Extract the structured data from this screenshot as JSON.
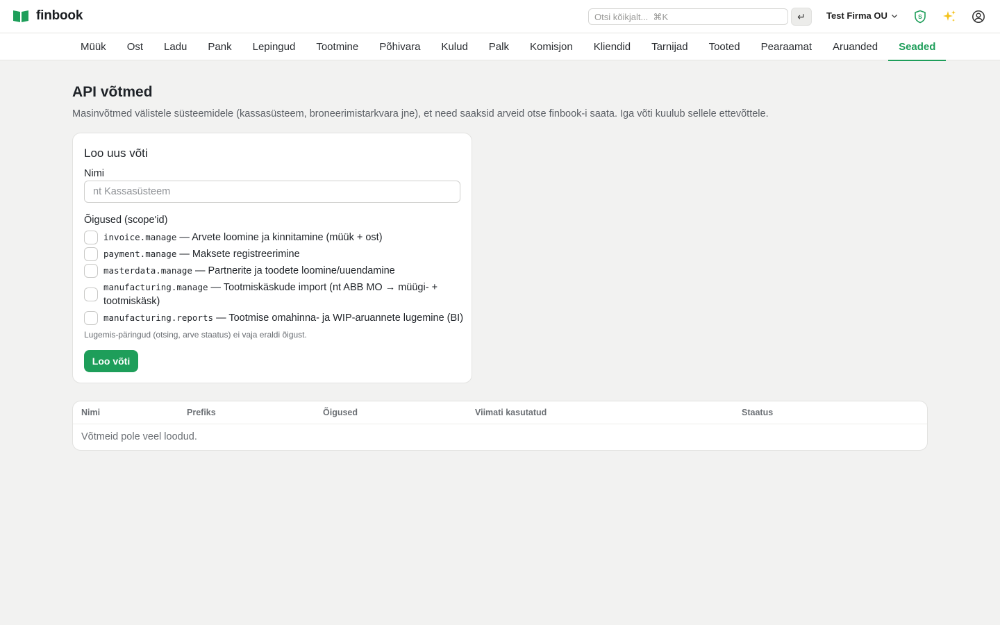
{
  "app": {
    "name": "finbook"
  },
  "search": {
    "placeholder": "Otsi kõikjalt...  ⌘K",
    "enter_label": "↵"
  },
  "company": {
    "name": "Test Firma OU"
  },
  "icons": {
    "logo": "open-book-icon",
    "shield": "shield-s-icon",
    "sparkles": "sparkles-icon",
    "user": "user-circle-icon",
    "chevron": "chevron-down-icon"
  },
  "colors": {
    "accent": "#1e9e5a",
    "background": "#f2f2f1"
  },
  "nav": {
    "tabs": [
      {
        "label": "Müük"
      },
      {
        "label": "Ost"
      },
      {
        "label": "Ladu"
      },
      {
        "label": "Pank"
      },
      {
        "label": "Lepingud"
      },
      {
        "label": "Tootmine"
      },
      {
        "label": "Põhivara"
      },
      {
        "label": "Kulud"
      },
      {
        "label": "Palk"
      },
      {
        "label": "Komisjon"
      },
      {
        "label": "Kliendid"
      },
      {
        "label": "Tarnijad"
      },
      {
        "label": "Tooted"
      },
      {
        "label": "Pearaamat"
      },
      {
        "label": "Aruanded"
      },
      {
        "label": "Seaded"
      }
    ],
    "active": "Seaded"
  },
  "page": {
    "title": "API võtmed",
    "description": "Masinvõtmed välistele süsteemidele (kassasüsteem, broneerimistarkvara jne), et need saaksid arveid otse finbook-i saata. Iga võti kuulub sellele ettevõttele."
  },
  "create": {
    "title": "Loo uus võti",
    "name_label": "Nimi",
    "name_placeholder": "nt Kassasüsteem",
    "scopes_label": "Õigused (scope'id)",
    "scopes": [
      {
        "code": "invoice.manage",
        "desc": "— Arvete loomine ja kinnitamine (müük + ost)"
      },
      {
        "code": "payment.manage",
        "desc": "— Maksete registreerimine"
      },
      {
        "code": "masterdata.manage",
        "desc": "— Partnerite ja toodete loomine/uuendamine"
      },
      {
        "code": "manufacturing.manage",
        "desc": "— Tootmiskäskude import (nt ABB MO → müügi- + tootmiskäsk)"
      },
      {
        "code": "manufacturing.reports",
        "desc": "— Tootmise omahinna- ja WIP-aruannete lugemine (BI)"
      }
    ],
    "hint": "Lugemis-päringud (otsing, arve staatus) ei vaja eraldi õigust.",
    "button": "Loo võti"
  },
  "keys_table": {
    "columns": [
      "Nimi",
      "Prefiks",
      "Õigused",
      "Viimati kasutatud",
      "Staatus"
    ],
    "rows": [],
    "empty_text": "Võtmeid pole veel loodud."
  }
}
